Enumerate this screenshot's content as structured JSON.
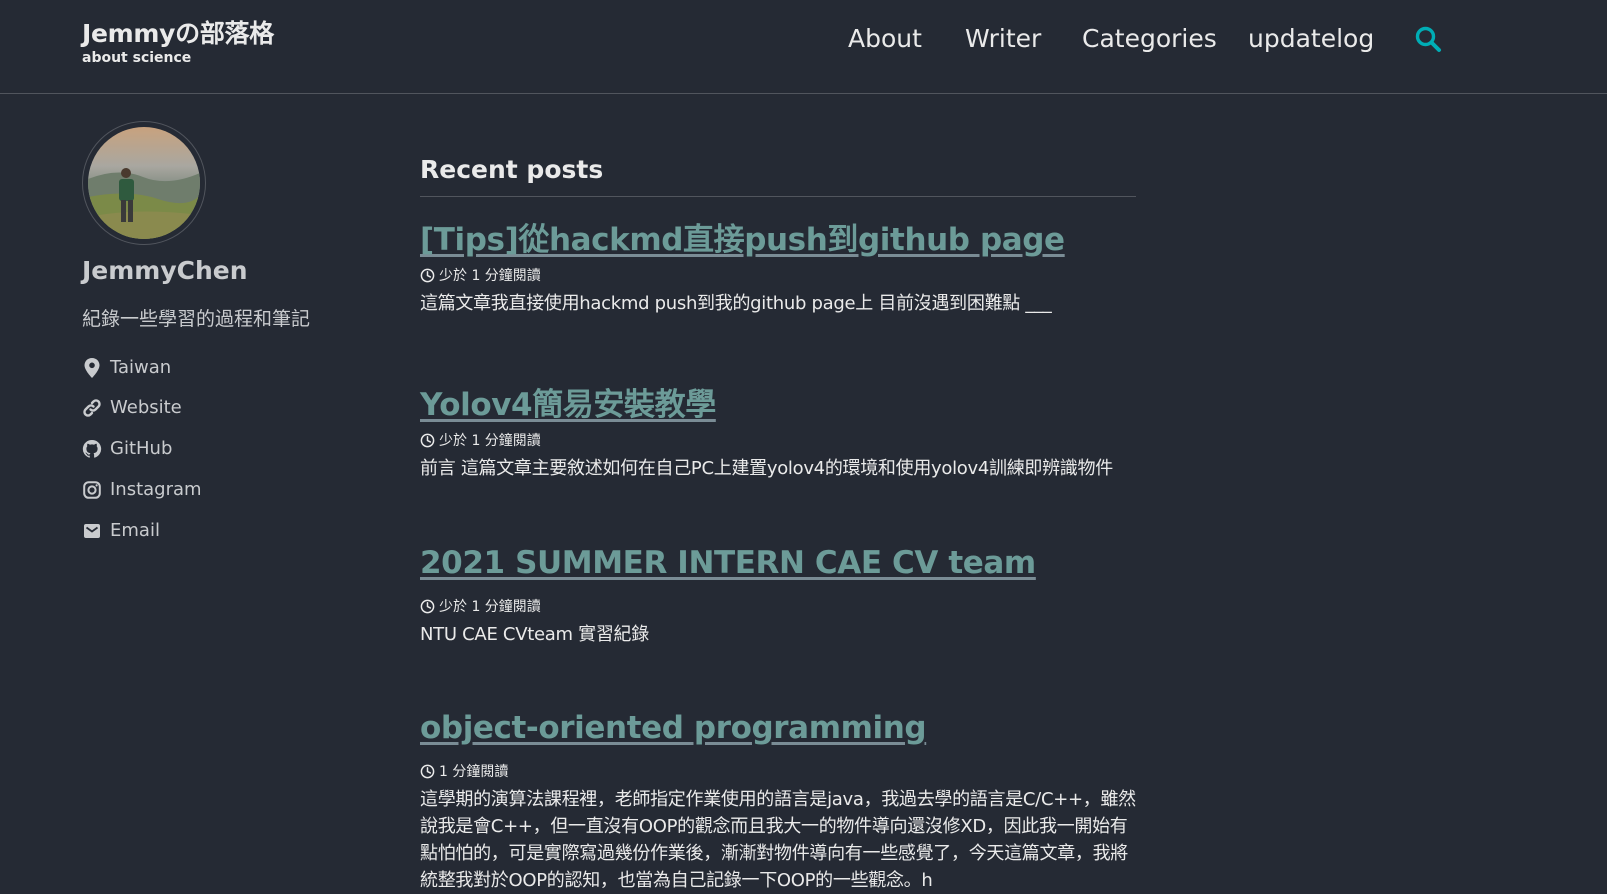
{
  "site": {
    "title": "Jemmyの部落格",
    "subtitle": "about science"
  },
  "nav": {
    "items": [
      "About",
      "Writer",
      "Categories",
      "updatelog"
    ]
  },
  "colors": {
    "accent": "#00adb5",
    "link": "#6c9b98",
    "background": "#252a34",
    "text": "#eaeaea"
  },
  "author": {
    "name": "JemmyChen",
    "bio": "紀錄一些學習的過程和筆記",
    "links": [
      {
        "label": "Taiwan",
        "icon": "map-marker-icon"
      },
      {
        "label": "Website",
        "icon": "link-icon"
      },
      {
        "label": "GitHub",
        "icon": "github-icon"
      },
      {
        "label": "Instagram",
        "icon": "instagram-icon"
      },
      {
        "label": "Email",
        "icon": "envelope-icon"
      }
    ]
  },
  "main": {
    "heading": "Recent posts",
    "posts": [
      {
        "title": "[Tips]從hackmd直接push到github page",
        "meta": "少於 1 分鐘閱讀",
        "excerpt": "這篇文章我直接使用hackmd push到我的github page上 目前沒遇到困難點 ___"
      },
      {
        "title": "Yolov4簡易安裝教學",
        "meta": "少於 1 分鐘閱讀",
        "excerpt": "前言 這篇文章主要敘述如何在自己PC上建置yolov4的環境和使用yolov4訓練即辨識物件"
      },
      {
        "title": "2021 SUMMER INTERN CAE CV team",
        "meta": "少於 1 分鐘閱讀",
        "excerpt": "NTU CAE CVteam 實習紀錄"
      },
      {
        "title": "object-oriented programming",
        "meta": "1 分鐘閱讀",
        "excerpt": "這學期的演算法課程裡，老師指定作業使用的語言是java，我過去學的語言是C/C++，雖然說我是會C++，但一直沒有OOP的觀念而且我大一的物件導向還沒修XD，因此我一開始有點怕怕的，可是實際寫過幾份作業後，漸漸對物件導向有一些感覺了，今天這篇文章，我將統整我對於OOP的認知，也當為自己記錄一下OOP的一些觀念。h"
      }
    ]
  }
}
